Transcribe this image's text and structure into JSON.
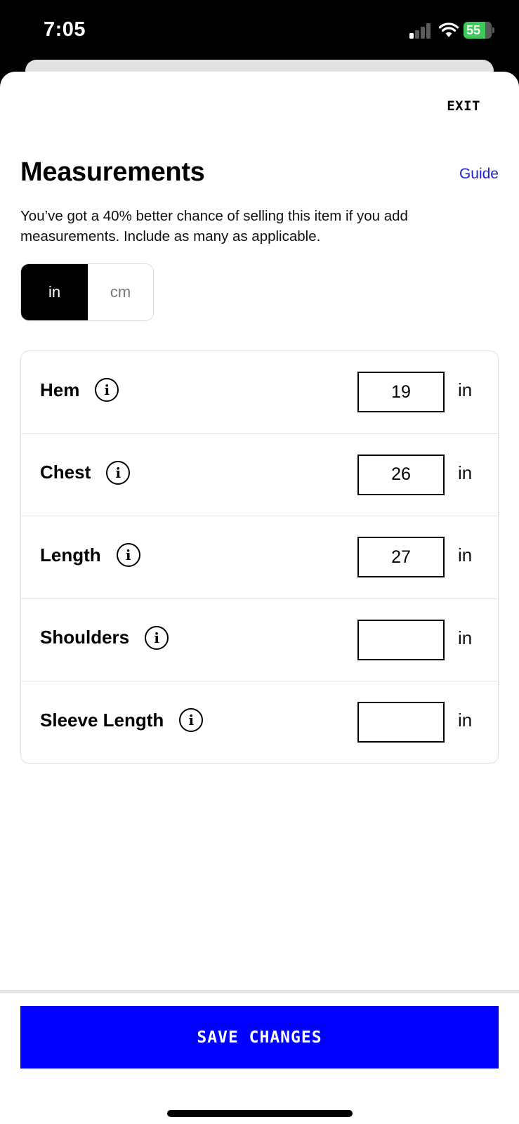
{
  "status_bar": {
    "time": "7:05",
    "battery_level": "55",
    "battery_charging": true,
    "signal_bars_active": 1,
    "icons": [
      "cellular-signal-icon",
      "wifi-icon",
      "battery-charging-icon"
    ]
  },
  "header": {
    "exit_label": "EXIT",
    "title": "Measurements",
    "guide_label": "Guide",
    "intro": "You’ve got a 40% better chance of selling this item if you add measurements. Include as many as applicable."
  },
  "unit_toggle": {
    "selected": "in",
    "options": [
      "in",
      "cm"
    ]
  },
  "measurements": {
    "unit": "in",
    "rows": [
      {
        "label": "Hem",
        "value": "19"
      },
      {
        "label": "Chest",
        "value": "26"
      },
      {
        "label": "Length",
        "value": "27"
      },
      {
        "label": "Shoulders",
        "value": ""
      },
      {
        "label": "Sleeve Length",
        "value": ""
      }
    ]
  },
  "footer": {
    "save_label": "SAVE CHANGES"
  },
  "colors": {
    "accent": "#0000ff",
    "link": "#1a1fd6",
    "battery": "#3ec95a"
  }
}
